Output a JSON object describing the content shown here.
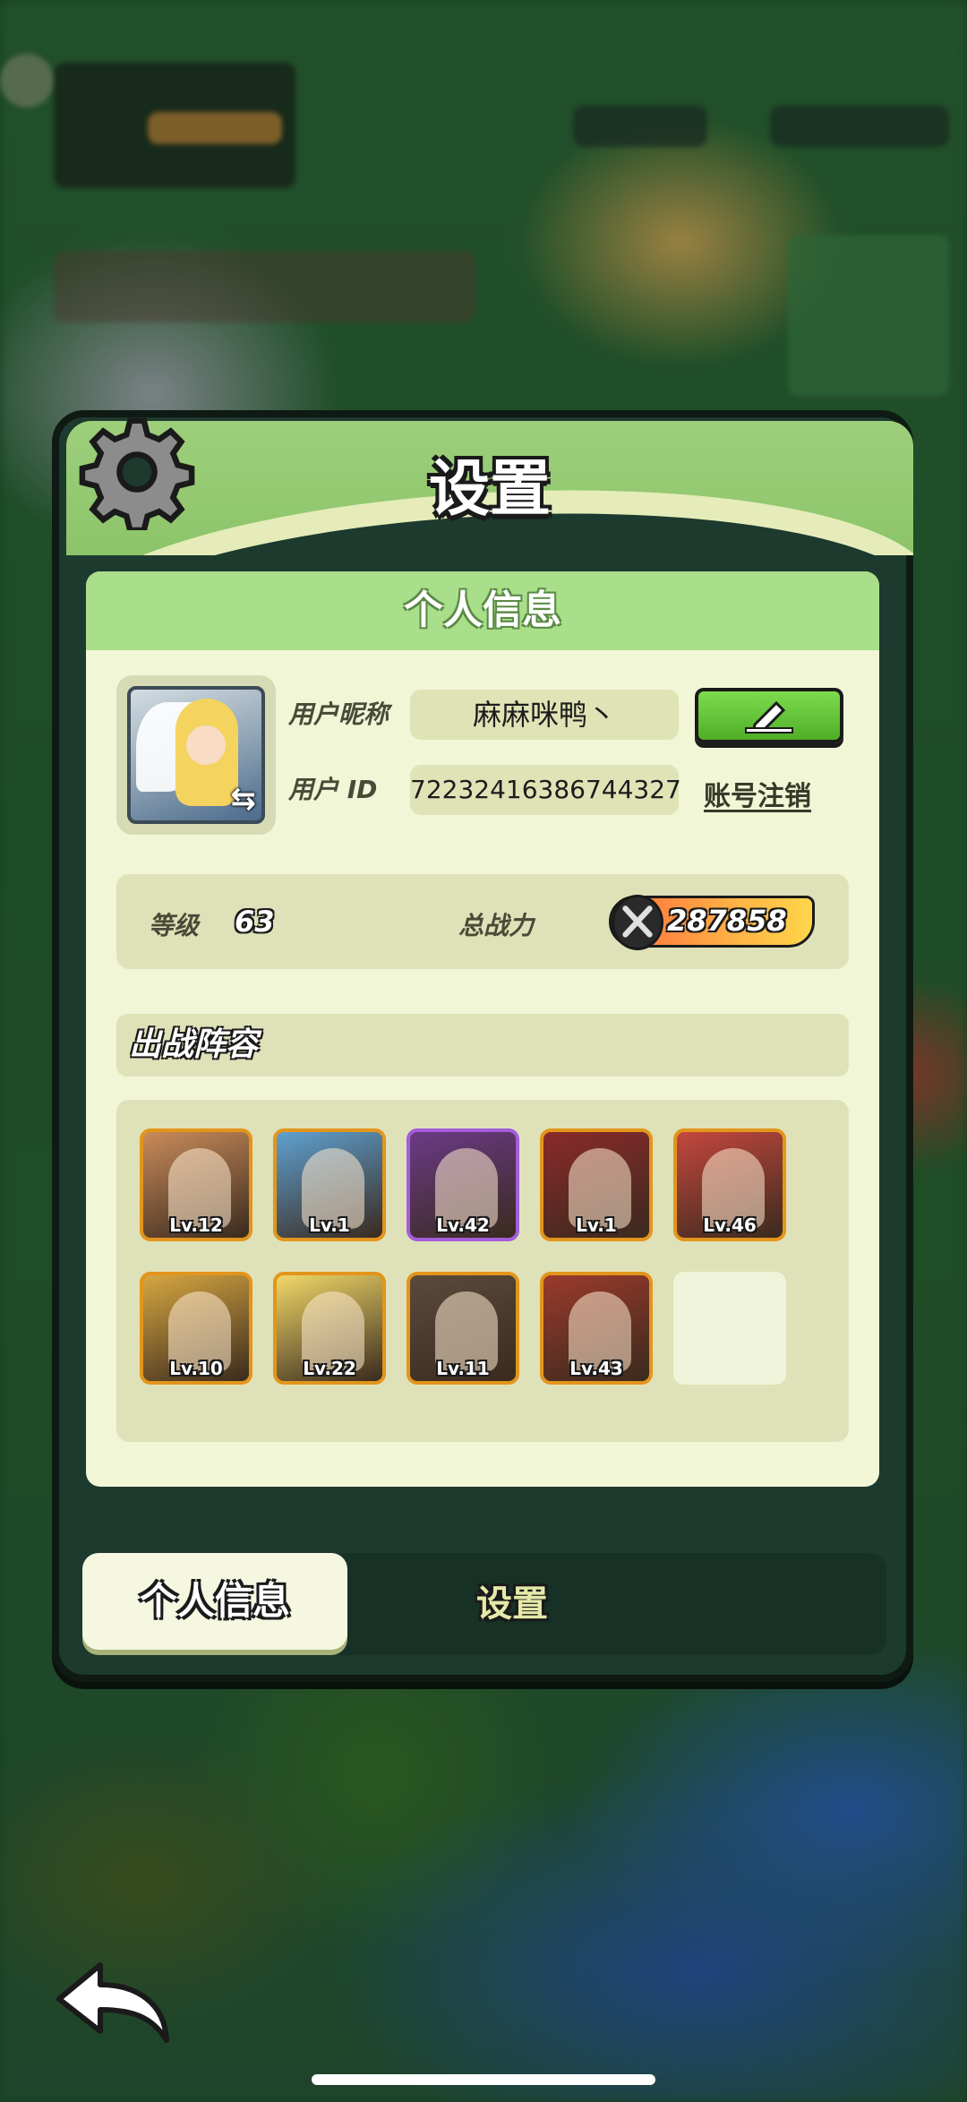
{
  "panel": {
    "title": "设置"
  },
  "profile": {
    "section_title": "个人信息",
    "nickname_label": "用户昵称",
    "nickname": "麻麻咪鸭丶",
    "id_label": "用户 ID",
    "user_id": "72232416386744327",
    "account_cancel": "账号注销",
    "level_label": "等级",
    "level": "63",
    "power_label": "总战力",
    "power": "287858"
  },
  "lineup": {
    "title": "出战阵容",
    "heroes": [
      {
        "level": "Lv.12",
        "color": "#c98b5a"
      },
      {
        "level": "Lv.1",
        "color": "#5fa0d0"
      },
      {
        "level": "Lv.42",
        "color": "#6b3a86"
      },
      {
        "level": "Lv.1",
        "color": "#8a2a2a"
      },
      {
        "level": "Lv.46",
        "color": "#c4473e"
      },
      {
        "level": "Lv.10",
        "color": "#d6a640"
      },
      {
        "level": "Lv.22",
        "color": "#f0d868"
      },
      {
        "level": "Lv.11",
        "color": "#5b4a3c"
      },
      {
        "level": "Lv.43",
        "color": "#9a3a2c"
      }
    ]
  },
  "tabs": {
    "active": "个人信息",
    "settings": "设置"
  },
  "icons": {
    "gear": "gear-icon",
    "edit": "pencil-icon",
    "back": "back-arrow-icon",
    "power": "crossed-swords-icon"
  }
}
